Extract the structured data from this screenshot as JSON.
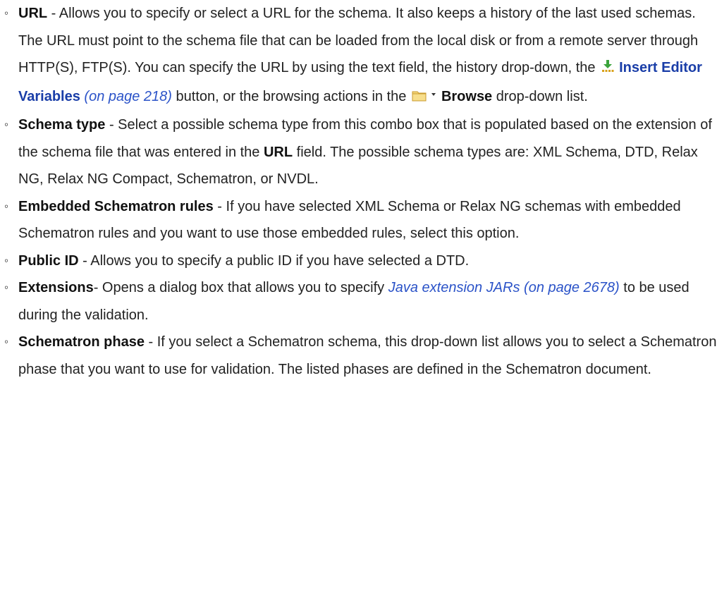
{
  "options": {
    "url": {
      "term": "URL",
      "text_1": " - Allows you to specify or select a URL for the schema. It also keeps a history of the last used schemas. The URL must point to the schema file that can be loaded from the local disk or from a remote server through HTTP(S), FTP(S). You can specify the URL by using the text field, the history drop-down, the ",
      "insert_icon": "insert-variables-icon",
      "insert_link": "Insert Editor Variables",
      "insert_ref": "(on page 218)",
      "text_2": " button, or the browsing actions in the ",
      "browse_icon": "folder-dropdown-icon",
      "browse_label": "Browse",
      "text_3": " drop-down list."
    },
    "schema_type": {
      "term": "Schema type",
      "text_1": " - Select a possible schema type from this combo box that is populated based on the extension of the schema file that was entered in the ",
      "url_term": "URL",
      "text_2": " field. The possible schema types are: XML Schema, DTD, Relax NG, Relax NG Compact, Schematron, or NVDL."
    },
    "embedded": {
      "term": "Embedded Schematron rules",
      "text": " - If you have selected XML Schema or Relax NG schemas with embedded Schematron rules and you want to use those embedded rules, select this option."
    },
    "public_id": {
      "term": "Public ID",
      "text": " - Allows you to specify a public ID if you have selected a DTD."
    },
    "extensions": {
      "term": "Extensions",
      "text_1": "- Opens a dialog box that allows you to specify ",
      "xref": "Java extension JARs (on page 2678)",
      "text_2": " to be used during the validation."
    },
    "phase": {
      "term": "Schematron phase",
      "text": " - If you select a Schematron schema, this drop-down list allows you to select a Schematron phase that you want to use for validation. The listed phases are defined in the Schematron document."
    }
  },
  "bullet_glyph": "◦"
}
